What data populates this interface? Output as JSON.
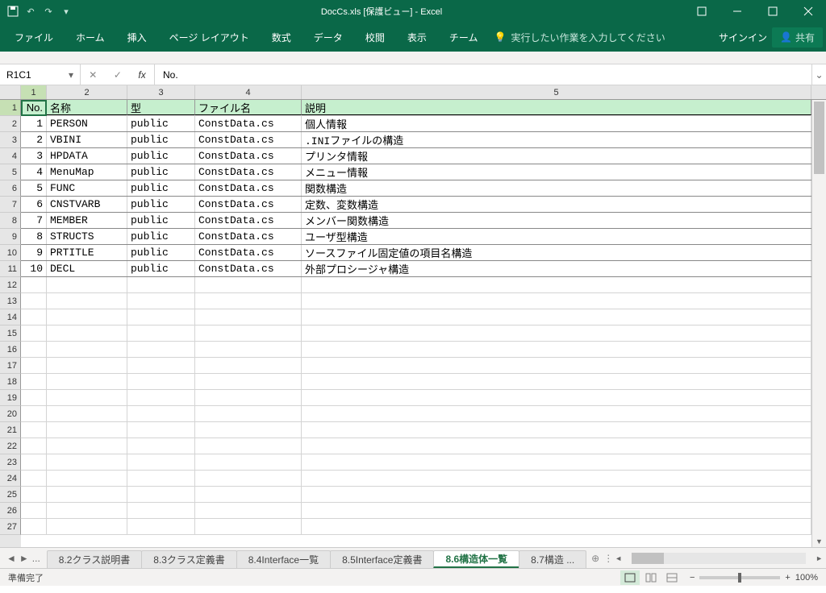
{
  "title": "DocCs.xls  [保護ビュー] - Excel",
  "qa": {
    "save": "save-icon",
    "undo": "undo-icon",
    "redo": "redo-icon",
    "more": "more-icon"
  },
  "ribbon": {
    "tabs": [
      "ファイル",
      "ホーム",
      "挿入",
      "ページ レイアウト",
      "数式",
      "データ",
      "校閲",
      "表示",
      "チーム"
    ],
    "tell_me": "実行したい作業を入力してください",
    "signin": "サインイン",
    "share": "共有"
  },
  "formula": {
    "namebox": "R1C1",
    "value": "No."
  },
  "columns": [
    "1",
    "2",
    "3",
    "4",
    "5"
  ],
  "col_widths_class": [
    "c-no",
    "c-name",
    "c-type",
    "c-file",
    "c-desc"
  ],
  "header_row": {
    "no": "No.",
    "name": "名称",
    "type": "型",
    "file": "ファイル名",
    "desc": "説明"
  },
  "rows": [
    {
      "no": "1",
      "name": "PERSON",
      "type": "public",
      "file": "ConstData.cs",
      "desc": "個人情報"
    },
    {
      "no": "2",
      "name": "VBINI",
      "type": "public",
      "file": "ConstData.cs",
      "desc": ".INIファイルの構造"
    },
    {
      "no": "3",
      "name": "HPDATA",
      "type": "public",
      "file": "ConstData.cs",
      "desc": "プリンタ情報"
    },
    {
      "no": "4",
      "name": "MenuMap",
      "type": "public",
      "file": "ConstData.cs",
      "desc": "メニュー情報"
    },
    {
      "no": "5",
      "name": "FUNC",
      "type": "public",
      "file": "ConstData.cs",
      "desc": "関数構造"
    },
    {
      "no": "6",
      "name": "CNSTVARB",
      "type": "public",
      "file": "ConstData.cs",
      "desc": "定数、変数構造"
    },
    {
      "no": "7",
      "name": "MEMBER",
      "type": "public",
      "file": "ConstData.cs",
      "desc": "メンバー関数構造"
    },
    {
      "no": "8",
      "name": "STRUCTS",
      "type": "public",
      "file": "ConstData.cs",
      "desc": "ユーザ型構造"
    },
    {
      "no": "9",
      "name": "PRTITLE",
      "type": "public",
      "file": "ConstData.cs",
      "desc": "ソースファイル固定値の項目名構造"
    },
    {
      "no": "10",
      "name": "DECL",
      "type": "public",
      "file": "ConstData.cs",
      "desc": "外部プロシージャ構造"
    }
  ],
  "empty_row_count": 16,
  "row_header_start": 1,
  "row_header_end": 27,
  "sheets": {
    "list": [
      "8.2クラス説明書",
      "8.3クラス定義書",
      "8.4Interface一覧",
      "8.5Interface定義書",
      "8.6構造体一覧",
      "8.7構造 ..."
    ],
    "active_index": 4
  },
  "status": {
    "ready": "準備完了",
    "zoom": "100%"
  }
}
